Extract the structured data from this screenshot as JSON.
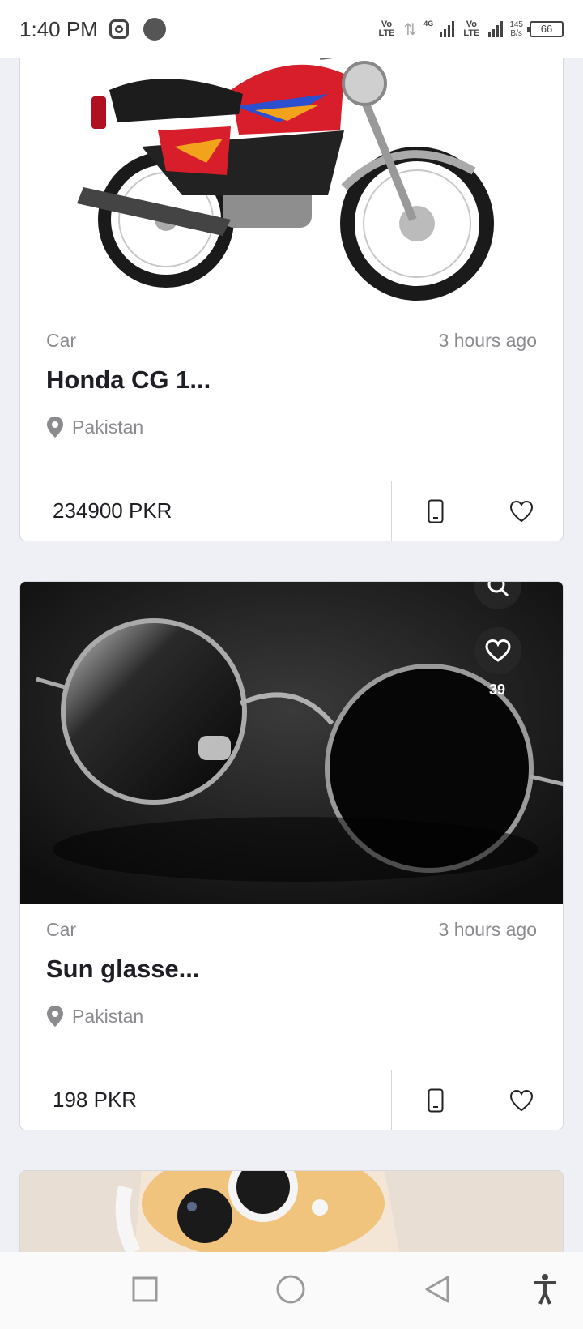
{
  "status_bar": {
    "time": "1:40 PM",
    "volte_1": "Vo LTE",
    "network": "4G",
    "volte_2": "Vo LTE",
    "speed_value": "145",
    "speed_unit": "B/s",
    "battery": "66"
  },
  "listings": [
    {
      "category": "Car",
      "time_ago": "3 hours ago",
      "title": "Honda CG 1...",
      "location": "Pakistan",
      "price": "234900 PKR",
      "image": "red-motorcycle"
    },
    {
      "category": "Car",
      "time_ago": "3 hours ago",
      "title": "Sun glasse...",
      "location": "Pakistan",
      "price": "198 PKR",
      "image": "round-sunglasses",
      "favorites_count": "39"
    },
    {
      "image": "phone-case"
    }
  ],
  "nav_bar": {
    "icons": [
      "recent-apps-icon",
      "home-icon",
      "back-icon",
      "accessibility-icon"
    ]
  }
}
